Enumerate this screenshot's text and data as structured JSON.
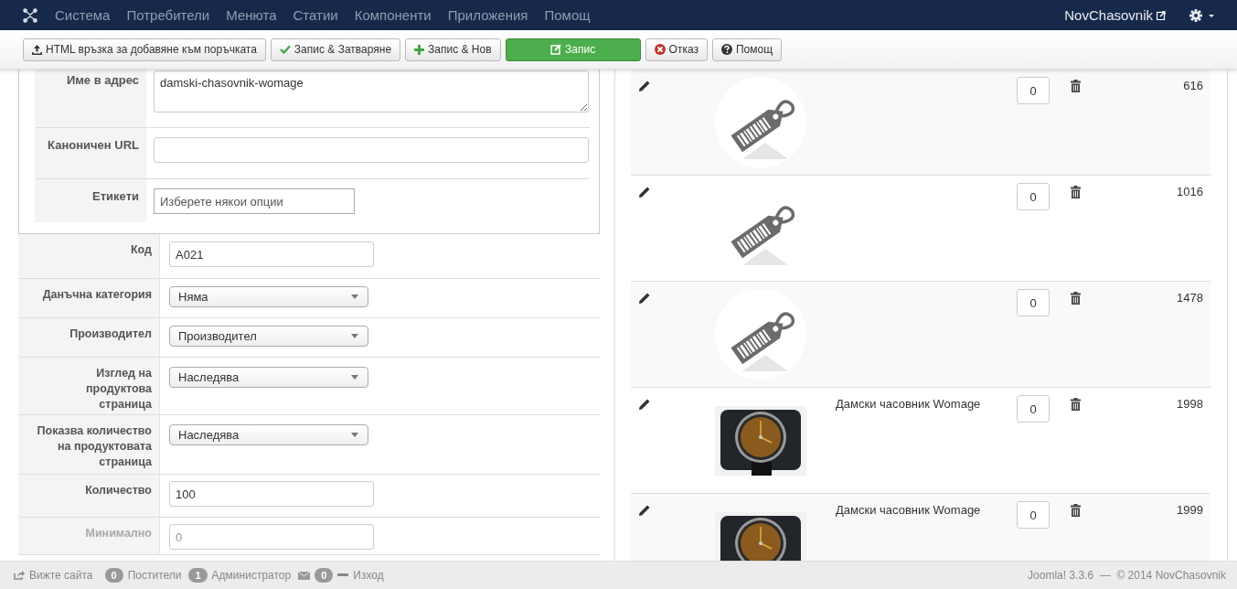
{
  "navbar": {
    "menu": [
      "Система",
      "Потребители",
      "Менюта",
      "Статии",
      "Компоненти",
      "Приложения",
      "Помощ"
    ],
    "site_name": "NovChasovnik"
  },
  "toolbar": [
    {
      "kind": "upload",
      "label": "HTML връзка за добавяне към поръчката",
      "primary": false
    },
    {
      "kind": "check",
      "label": "Запис & Затваряне",
      "primary": false
    },
    {
      "kind": "plus",
      "label": "Запис & Нов",
      "primary": false
    },
    {
      "kind": "edit",
      "label": "Запис",
      "primary": true
    },
    {
      "kind": "cancel",
      "label": "Отказ",
      "primary": false
    },
    {
      "kind": "help",
      "label": "Помощ",
      "primary": false
    }
  ],
  "seo_fields": [
    {
      "kind": "textarea",
      "label": "Име в адрес",
      "value": "damski-chasovnik-womage"
    },
    {
      "kind": "text",
      "label": "Каноничен URL"
    },
    {
      "kind": "tags",
      "label": "Етикети",
      "placeholder": "Изберете някои опции"
    }
  ],
  "product_fields": [
    {
      "kind": "text",
      "label": "Код",
      "value": "A021"
    },
    {
      "kind": "select",
      "label": "Данъчна категория",
      "value": "Няма"
    },
    {
      "kind": "select",
      "label": "Производител",
      "value": "Производител"
    },
    {
      "kind": "select",
      "label": "Изглед на продуктова страница",
      "value": "Наследява"
    },
    {
      "kind": "select",
      "label": "Показва количество на продуктовата страница",
      "value": "Наследява"
    },
    {
      "kind": "text",
      "label": "Количество",
      "value": "100"
    },
    {
      "kind": "text",
      "label": "Минимално",
      "value": "0"
    }
  ],
  "images": [
    {
      "kind": "placeholder",
      "quantity": "0",
      "id": "616"
    },
    {
      "kind": "placeholder",
      "quantity": "0",
      "id": "1016"
    },
    {
      "kind": "placeholder",
      "quantity": "0",
      "id": "1478"
    },
    {
      "name": "Дамски часовник Womage",
      "quantity": "0",
      "id": "1998"
    },
    {
      "name": "Дамски часовник Womage",
      "quantity": "0",
      "id": "1999"
    }
  ],
  "status_bar": {
    "view_site": "Вижте сайта",
    "visitors_count": "0",
    "visitors": "Постители",
    "admins_count": "1",
    "admins": "Администратор",
    "messages_count": "0",
    "logout": "Изход",
    "footer": "Joomla! 3.3.6  —  © 2014 NovChasovnik"
  }
}
